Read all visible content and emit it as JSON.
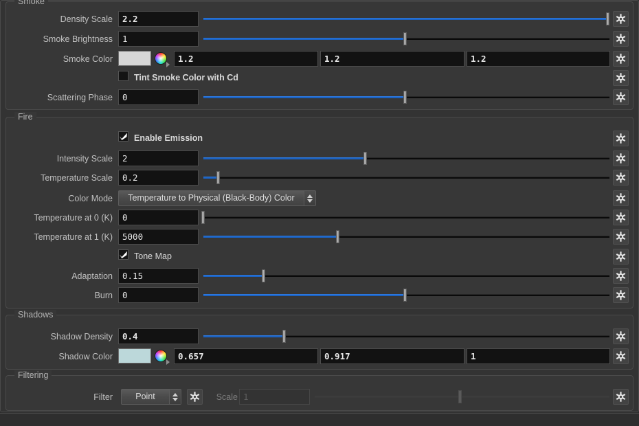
{
  "groups": {
    "smoke": {
      "title": "Smoke"
    },
    "fire": {
      "title": "Fire"
    },
    "shadows": {
      "title": "Shadows"
    },
    "filtering": {
      "title": "Filtering"
    }
  },
  "rows": {
    "density_scale": {
      "label": "Density Scale",
      "value": "2.2"
    },
    "smoke_brightness": {
      "label": "Smoke Brightness",
      "value": "1"
    },
    "smoke_color": {
      "label": "Smoke Color",
      "r": "1.2",
      "g": "1.2",
      "b": "1.2",
      "swatch": "#d6d6d6"
    },
    "tint_smoke": {
      "label": "Tint Smoke Color with Cd",
      "checked": false
    },
    "scattering_phase": {
      "label": "Scattering Phase",
      "value": "0"
    },
    "enable_emission": {
      "label": "Enable Emission",
      "checked": true
    },
    "intensity_scale": {
      "label": "Intensity Scale",
      "value": "2"
    },
    "temperature_scale": {
      "label": "Temperature Scale",
      "value": "0.2"
    },
    "color_mode": {
      "label": "Color Mode",
      "value": "Temperature to Physical (Black-Body) Color"
    },
    "temp_at_0": {
      "label": "Temperature at 0 (K)",
      "value": "0"
    },
    "temp_at_1": {
      "label": "Temperature at 1 (K)",
      "value": "5000"
    },
    "tone_map": {
      "label": "Tone Map",
      "checked": true
    },
    "adaptation": {
      "label": "Adaptation",
      "value": "0.15"
    },
    "burn": {
      "label": "Burn",
      "value": "0"
    },
    "shadow_density": {
      "label": "Shadow Density",
      "value": "0.4"
    },
    "shadow_color": {
      "label": "Shadow Color",
      "r": "0.657",
      "g": "0.917",
      "b": "1",
      "swatch": "#bcd8da"
    },
    "filter": {
      "label": "Filter",
      "value": "Point"
    },
    "scale": {
      "label": "Scale",
      "value": "1"
    }
  },
  "colors": {
    "accent_blue": "#1b63c4",
    "panel_bg": "#373737",
    "field_bg": "#121212"
  }
}
